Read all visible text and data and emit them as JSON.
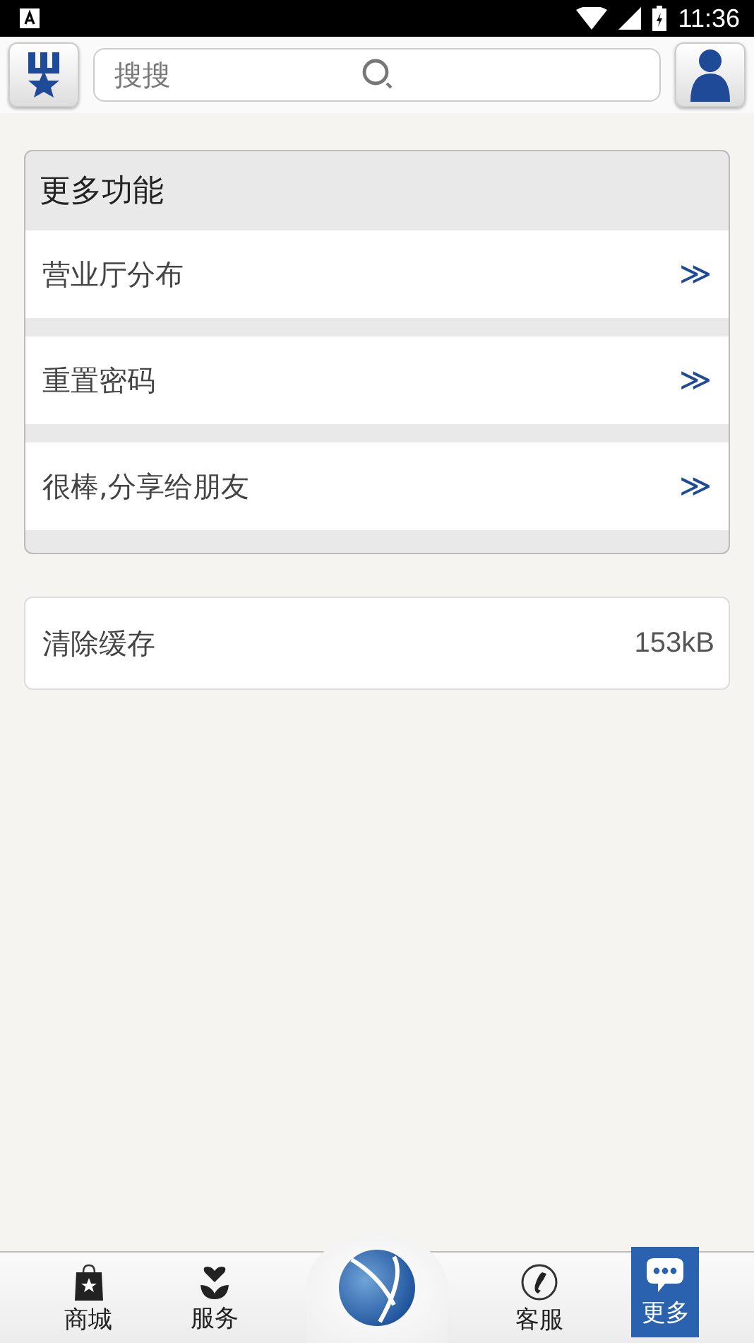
{
  "status_bar": {
    "time": "11:36"
  },
  "search": {
    "placeholder": "搜搜"
  },
  "more_section": {
    "title": "更多功能",
    "items": [
      {
        "label": "营业厅分布",
        "arrow": "≫"
      },
      {
        "label": "重置密码",
        "arrow": "≫"
      },
      {
        "label": "很棒,分享给朋友",
        "arrow": "≫"
      }
    ]
  },
  "cache": {
    "label": "清除缓存",
    "value": "153kB"
  },
  "bottom_nav": [
    {
      "label": "商城",
      "kind": "shop",
      "selected": false
    },
    {
      "label": "服务",
      "kind": "service",
      "selected": false
    },
    {
      "kind": "center"
    },
    {
      "label": "客服",
      "kind": "phone",
      "selected": false
    },
    {
      "label": "更多",
      "kind": "more",
      "selected": true
    }
  ]
}
